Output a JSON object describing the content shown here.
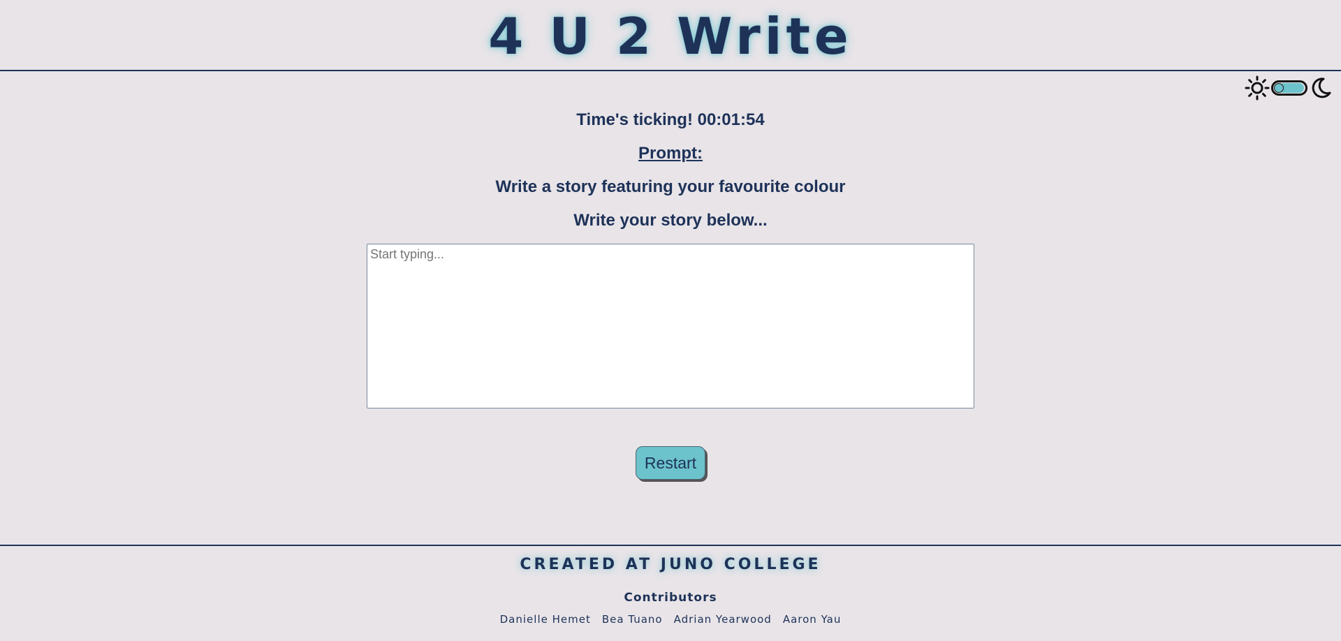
{
  "header": {
    "title": "4 U 2 Write"
  },
  "theme_toggle": {
    "light_icon": "sun-icon",
    "dark_icon": "moon-icon",
    "accent_color": "#6cc3cc"
  },
  "main": {
    "timer": "Time's ticking! 00:01:54",
    "prompt_heading": "Prompt:",
    "prompt_text": "Write a story featuring your favourite colour",
    "write_label": "Write your story below...",
    "story_placeholder": "Start typing...",
    "story_value": "",
    "restart_label": "Restart"
  },
  "footer": {
    "title": "CREATED AT JUNO COLLEGE",
    "contributors_heading": "Contributors",
    "contributors": [
      "Danielle Hemet",
      "Bea Tuano",
      "Adrian Yearwood",
      "Aaron Yau"
    ]
  },
  "colors": {
    "background": "#e8e4e8",
    "primary_text": "#1e3258",
    "accent": "#6cc3cc"
  }
}
